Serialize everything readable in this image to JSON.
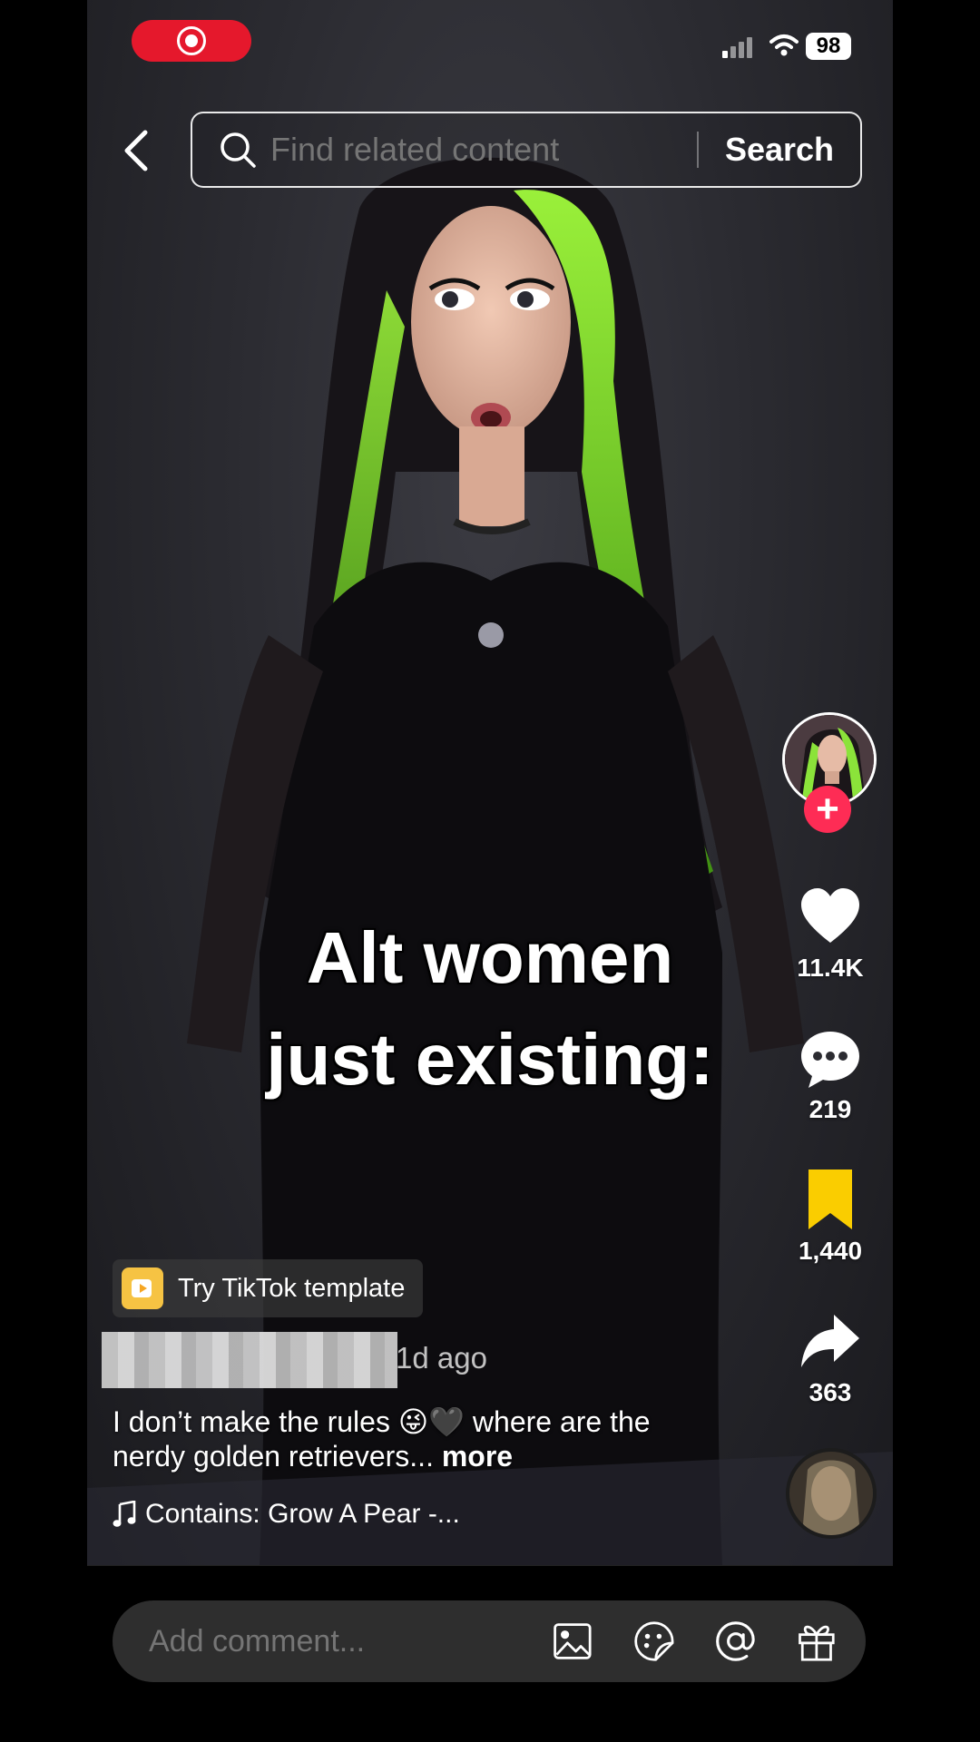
{
  "status_bar": {
    "battery": "98",
    "recording_icon": "screen-record-icon",
    "wifi_icon": "wifi-icon",
    "signal_icon": "cellular-signal-icon"
  },
  "search": {
    "placeholder": "Find related content",
    "button_label": "Search",
    "back_icon": "chevron-left-icon",
    "search_icon": "magnifier-icon"
  },
  "video": {
    "overlay_line1": "Alt women",
    "overlay_line2": "just existing:"
  },
  "actions": {
    "likes": "11.4K",
    "comments": "219",
    "saves": "1,440",
    "shares": "363",
    "follow_label": "+"
  },
  "info": {
    "template_label": "Try TikTok template",
    "time_ago": "1d ago",
    "description_pre": "I don’t make the rules 😜🖤 where are the nerdy golden retrievers...",
    "description_more": "more",
    "sound": "Contains: Grow A Pear -..."
  },
  "comment_bar": {
    "placeholder": "Add comment..."
  },
  "colors": {
    "accent_red": "#fe2c55",
    "bookmark_yellow": "#facd00",
    "hair_green": "#7bdc2a"
  }
}
